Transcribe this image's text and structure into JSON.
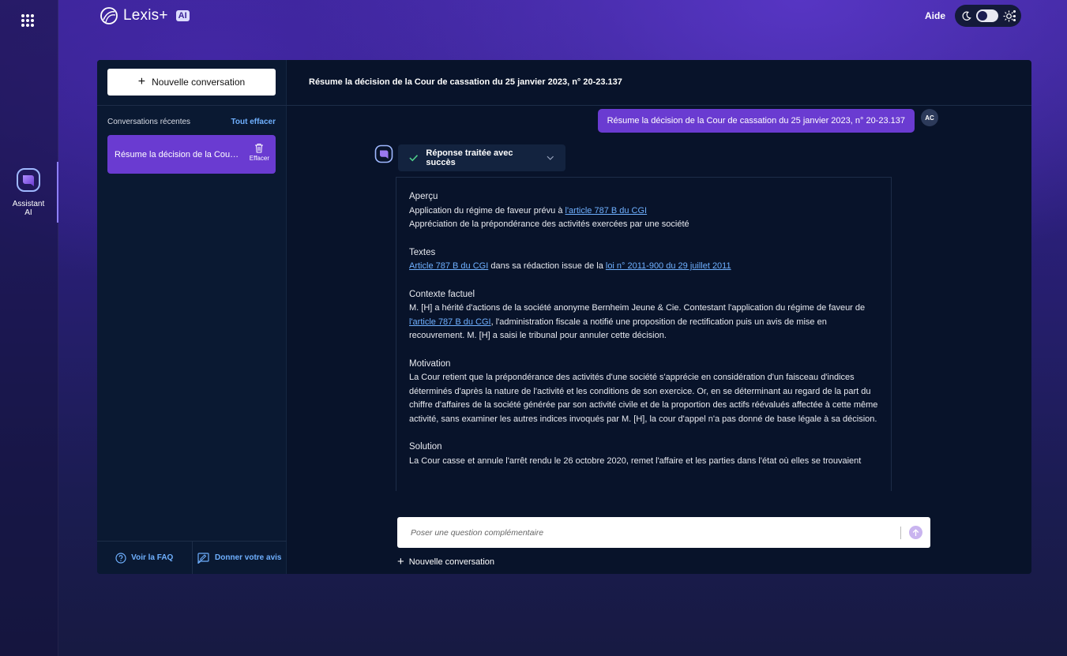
{
  "app": {
    "brand": "Lexis+",
    "ai_tag": "AI",
    "help": "Aide"
  },
  "rail": {
    "assistant_label": "Assistant AI"
  },
  "sidebar": {
    "new_conversation": "Nouvelle conversation",
    "recent_title": "Conversations récentes",
    "clear_all": "Tout effacer",
    "conversations": [
      {
        "label": "Résume la décision de la Cour de cassation du 25 janvier 2023, n° 20-23.137",
        "delete_label": "Effacer"
      }
    ],
    "faq": "Voir la FAQ",
    "feedback": "Donner votre avis"
  },
  "conversation": {
    "title": "Résume la décision de la Cour de cassation du 25 janvier 2023, n° 20-23.137",
    "user_message": "Résume la décision de la Cour de cassation du 25 janvier 2023, n° 20-23.137",
    "user_initials": "AC",
    "status": "Réponse traitée avec succès",
    "answer": {
      "apercu_title": "Aperçu",
      "apercu_line1_pre": "Application du régime de faveur prévu à ",
      "apercu_line1_link": "l'article 787 B du CGI",
      "apercu_line2": "Appréciation de la prépondérance des activités exercées par une société",
      "textes_title": "Textes",
      "textes_link1": "Article 787 B du CGI",
      "textes_mid": " dans sa rédaction issue de la ",
      "textes_link2": "loi n° 2011-900 du 29 juillet 2011",
      "contexte_title": "Contexte factuel",
      "contexte_pre": "M. [H] a hérité d'actions de la société anonyme Bernheim Jeune & Cie. Contestant l'application du régime de faveur de ",
      "contexte_link": "l'article 787 B du CGI",
      "contexte_post": ", l'administration fiscale a notifié une proposition de rectification puis un avis de mise en recouvrement. M. [H] a saisi le tribunal pour annuler cette décision.",
      "motivation_title": "Motivation",
      "motivation_text": "La Cour retient que la prépondérance des activités d'une société s'apprécie en considération d'un faisceau d'indices déterminés d'après la nature de l'activité et les conditions de son exercice. Or, en se déterminant au regard de la part du chiffre d'affaires de la société générée par son activité civile et de la proportion des actifs réévalués affectée à cette même activité, sans examiner les autres indices invoqués par M. [H], la cour d'appel n'a pas donné de base légale à sa décision.",
      "solution_title": "Solution",
      "solution_text": "La Cour casse et annule l'arrêt rendu le 26 octobre 2020, remet l'affaire et les parties dans l'état où elles se trouvaient"
    },
    "ask_placeholder": "Poser une question complémentaire",
    "new_conversation": "Nouvelle conversation"
  },
  "colors": {
    "accent": "#6a3bd1",
    "link": "#6fb0ff",
    "panel": "#08132a"
  }
}
